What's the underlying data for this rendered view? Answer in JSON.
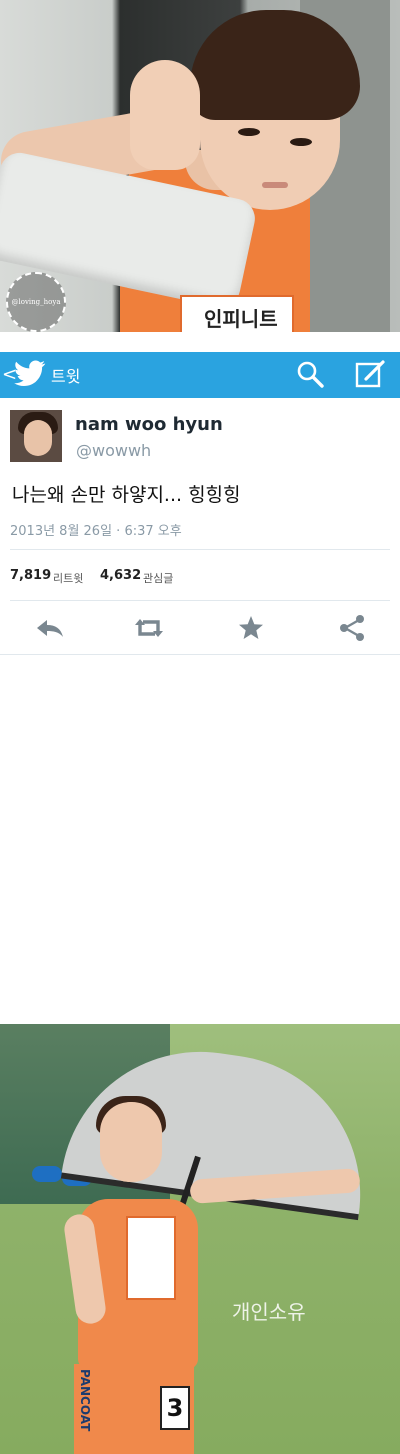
{
  "header": {
    "back": "<",
    "title": "트윗"
  },
  "tweet": {
    "display_name": "nam woo hyun",
    "handle": "@wowwh",
    "text": "나는왜 손만 하얗지... 힝힝힝",
    "date": "2013년 8월 26일 · 6:37 오후",
    "retweets": "7,819",
    "retweets_label": "리트윗",
    "favorites": "4,632",
    "favorites_label": "관심글"
  },
  "photo_top": {
    "watermark": "@loving_hoya",
    "bib_text": "인피니트"
  },
  "photo_bottom": {
    "bib_number": "3",
    "brand": "PANCOAT",
    "watermark": "개인소유"
  },
  "icons": [
    "bird-icon",
    "search-icon",
    "compose-icon",
    "reply-icon",
    "retweet-icon",
    "star-icon",
    "share-icon"
  ],
  "colors": {
    "header": "#2aa3e0",
    "muted": "#8a9aa6"
  }
}
